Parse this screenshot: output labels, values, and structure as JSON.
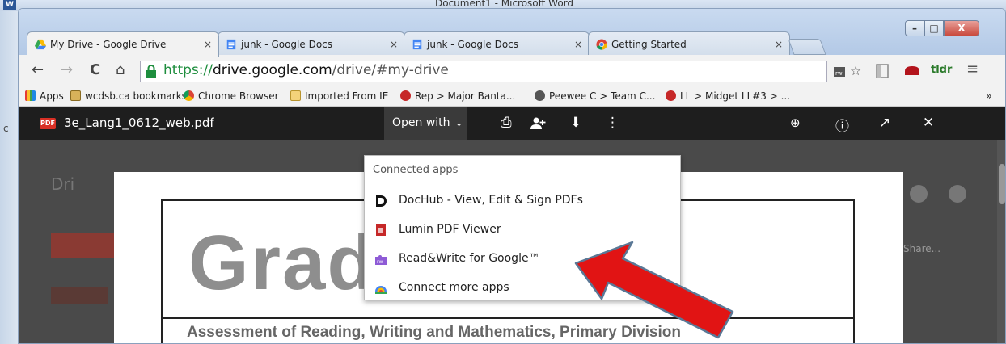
{
  "word_window": {
    "title": "Document1 - Microsoft Word",
    "app_icon": "W",
    "left_char": "c"
  },
  "chrome": {
    "tabs": [
      {
        "label": "My Drive - Google Drive",
        "close": "×",
        "icon": "google-drive-icon"
      },
      {
        "label": "junk - Google Docs",
        "close": "×",
        "icon": "google-docs-icon"
      },
      {
        "label": "junk - Google Docs",
        "close": "×",
        "icon": "google-docs-icon"
      },
      {
        "label": "Getting Started",
        "close": "×",
        "icon": "chrome-icon"
      }
    ],
    "window_controls": {
      "minimize": "–",
      "maximize": "□",
      "close": "X"
    },
    "nav": {
      "back": "←",
      "forward": "→",
      "reload": "C",
      "home": "⌂"
    },
    "url": {
      "scheme": "https://",
      "host": "drive.google.com",
      "path": "/drive/#my-drive"
    },
    "toolbar_icons": {
      "star": "☆",
      "menu": "≡",
      "tldr": "tldr"
    },
    "bookmarks": [
      {
        "label": "Apps",
        "icon": "apps-grid-icon"
      },
      {
        "label": "wcdsb.ca bookmarks",
        "icon": "folder-icon"
      },
      {
        "label": "Chrome Browser",
        "icon": "chrome-icon"
      },
      {
        "label": "Imported From IE",
        "icon": "folder-icon"
      },
      {
        "label": "Rep > Major Banta...",
        "icon": "bookmark-site-icon"
      },
      {
        "label": "Peewee C > Team C...",
        "icon": "bookmark-site-icon"
      },
      {
        "label": "LL > Midget LL#3 > ...",
        "icon": "bookmark-site-icon"
      }
    ],
    "bookmarks_overflow": "»"
  },
  "viewer": {
    "file_badge": "PDF",
    "filename": "3e_Lang1_0612_web.pdf",
    "open_with": "Open with",
    "open_with_chevron": "⌄",
    "actions": {
      "print": "⎙",
      "add_person": "+",
      "download": "⬇",
      "more": "⋮",
      "zoom": "⊕",
      "info": "ⓘ",
      "popout": "↗",
      "close": "✕"
    }
  },
  "drive_background": {
    "title": "Dri",
    "share_text": "Share..."
  },
  "dropdown": {
    "header": "Connected apps",
    "items": [
      {
        "label": "DocHub - View, Edit & Sign PDFs",
        "icon": "dochub-icon"
      },
      {
        "label": "Lumin PDF Viewer",
        "icon": "lumin-icon"
      },
      {
        "label": "Read&Write for Google™",
        "icon": "readwrite-icon"
      },
      {
        "label": "Connect more apps",
        "icon": "connect-apps-icon"
      }
    ]
  },
  "pdf": {
    "heading": "Grade 3",
    "subtitle": "Assessment of Reading, Writing and Mathematics, Primary Division"
  },
  "colors": {
    "arrow": "#e11414",
    "pdf_badge": "#d93025",
    "viewer_bar": "#1e1e1e"
  }
}
